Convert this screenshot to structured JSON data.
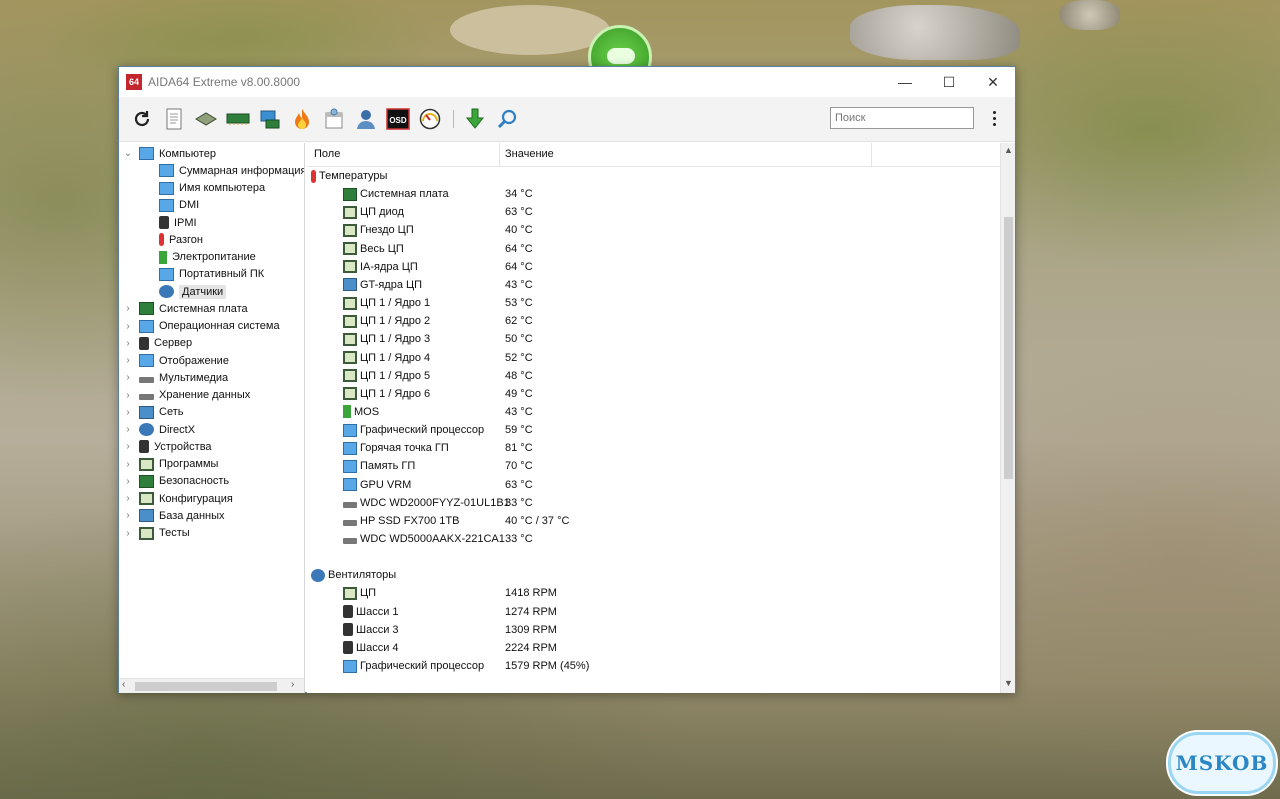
{
  "window": {
    "app_icon_text": "64",
    "title": "AIDA64 Extreme v8.00.8000",
    "minimize": "—",
    "maximize": "☐",
    "close": "✕"
  },
  "toolbar": {
    "icons": [
      "refresh-icon",
      "report-icon",
      "memory-icon",
      "ram-icon",
      "network-icon",
      "flame-icon",
      "schedule-icon",
      "user-icon",
      "osd-icon",
      "gauge-icon",
      "download-icon",
      "search-icon"
    ],
    "osd_label": "OSD",
    "search_placeholder": "Поиск"
  },
  "tree": {
    "items": [
      {
        "label": "Компьютер",
        "level": 0,
        "expanded": true,
        "icon": "computer-icon"
      },
      {
        "label": "Суммарная информация",
        "level": 1,
        "icon": "computer-icon"
      },
      {
        "label": "Имя компьютера",
        "level": 1,
        "icon": "computer-icon"
      },
      {
        "label": "DMI",
        "level": 1,
        "icon": "computer-icon"
      },
      {
        "label": "IPMI",
        "level": 1,
        "icon": "phone-icon"
      },
      {
        "label": "Разгон",
        "level": 1,
        "icon": "flame-icon"
      },
      {
        "label": "Электропитание",
        "level": 1,
        "icon": "battery-icon"
      },
      {
        "label": "Портативный ПК",
        "level": 1,
        "icon": "computer-icon"
      },
      {
        "label": "Датчики",
        "level": 1,
        "icon": "gauge-icon",
        "selected": true
      },
      {
        "label": "Системная плата",
        "level": 0,
        "icon": "board-icon"
      },
      {
        "label": "Операционная система",
        "level": 0,
        "icon": "windows-icon"
      },
      {
        "label": "Сервер",
        "level": 0,
        "icon": "phone-icon"
      },
      {
        "label": "Отображение",
        "level": 0,
        "icon": "monitor-icon"
      },
      {
        "label": "Мультимедиа",
        "level": 0,
        "icon": "speaker-icon"
      },
      {
        "label": "Хранение данных",
        "level": 0,
        "icon": "storage-icon"
      },
      {
        "label": "Сеть",
        "level": 0,
        "icon": "network-icon"
      },
      {
        "label": "DirectX",
        "level": 0,
        "icon": "xbox-icon"
      },
      {
        "label": "Устройства",
        "level": 0,
        "icon": "devices-icon"
      },
      {
        "label": "Программы",
        "level": 0,
        "icon": "programs-icon"
      },
      {
        "label": "Безопасность",
        "level": 0,
        "icon": "shield-icon"
      },
      {
        "label": "Конфигурация",
        "level": 0,
        "icon": "config-icon"
      },
      {
        "label": "База данных",
        "level": 0,
        "icon": "database-icon"
      },
      {
        "label": "Тесты",
        "level": 0,
        "icon": "tests-icon"
      }
    ]
  },
  "list": {
    "col_field": "Поле",
    "col_value": "Значение",
    "rows": [
      {
        "type": "group",
        "field": "Температуры",
        "icon": "thermometer-icon"
      },
      {
        "field": "Системная плата",
        "value": "34 °C",
        "icon": "board-icon"
      },
      {
        "field": "ЦП диод",
        "value": "63 °C",
        "icon": "chip-icon"
      },
      {
        "field": "Гнездо ЦП",
        "value": "40 °C",
        "icon": "chip-icon"
      },
      {
        "field": "Весь ЦП",
        "value": "64 °C",
        "icon": "chip-icon"
      },
      {
        "field": "IA-ядра ЦП",
        "value": "64 °C",
        "icon": "chip-icon"
      },
      {
        "field": "GT-ядра ЦП",
        "value": "43 °C",
        "icon": "gpu-icon"
      },
      {
        "field": "ЦП 1 / Ядро 1",
        "value": "53 °C",
        "icon": "chip-icon"
      },
      {
        "field": "ЦП 1 / Ядро 2",
        "value": "62 °C",
        "icon": "chip-icon"
      },
      {
        "field": "ЦП 1 / Ядро 3",
        "value": "50 °C",
        "icon": "chip-icon"
      },
      {
        "field": "ЦП 1 / Ядро 4",
        "value": "52 °C",
        "icon": "chip-icon"
      },
      {
        "field": "ЦП 1 / Ядро 5",
        "value": "48 °C",
        "icon": "chip-icon"
      },
      {
        "field": "ЦП 1 / Ядро 6",
        "value": "49 °C",
        "icon": "chip-icon"
      },
      {
        "field": "MOS",
        "value": "43 °C",
        "icon": "battery-icon"
      },
      {
        "field": "Графический процессор",
        "value": "59 °C",
        "icon": "monitor-icon"
      },
      {
        "field": "Горячая точка ГП",
        "value": "81 °C",
        "icon": "monitor-icon"
      },
      {
        "field": "Память ГП",
        "value": "70 °C",
        "icon": "monitor-icon"
      },
      {
        "field": "GPU VRM",
        "value": "63 °C",
        "icon": "monitor-icon"
      },
      {
        "field": "WDC WD2000FYYZ-01UL1B1",
        "value": "33 °C",
        "icon": "disk-icon"
      },
      {
        "field": "HP SSD FX700 1TB",
        "value": "40 °C / 37 °C",
        "icon": "disk-icon"
      },
      {
        "field": "WDC WD5000AAKX-221CA1",
        "value": "33 °C",
        "icon": "disk-icon"
      },
      {
        "type": "spacer"
      },
      {
        "type": "group",
        "field": "Вентиляторы",
        "icon": "fan-icon"
      },
      {
        "field": "ЦП",
        "value": "1418 RPM",
        "icon": "chip-icon"
      },
      {
        "field": "Шасси 1",
        "value": "1274 RPM",
        "icon": "phone-icon"
      },
      {
        "field": "Шасси 3",
        "value": "1309 RPM",
        "icon": "phone-icon"
      },
      {
        "field": "Шасси 4",
        "value": "2224 RPM",
        "icon": "phone-icon"
      },
      {
        "field": "Графический процессор",
        "value": "1579 RPM  (45%)",
        "icon": "monitor-icon"
      }
    ]
  },
  "watermark": "MSKOB"
}
